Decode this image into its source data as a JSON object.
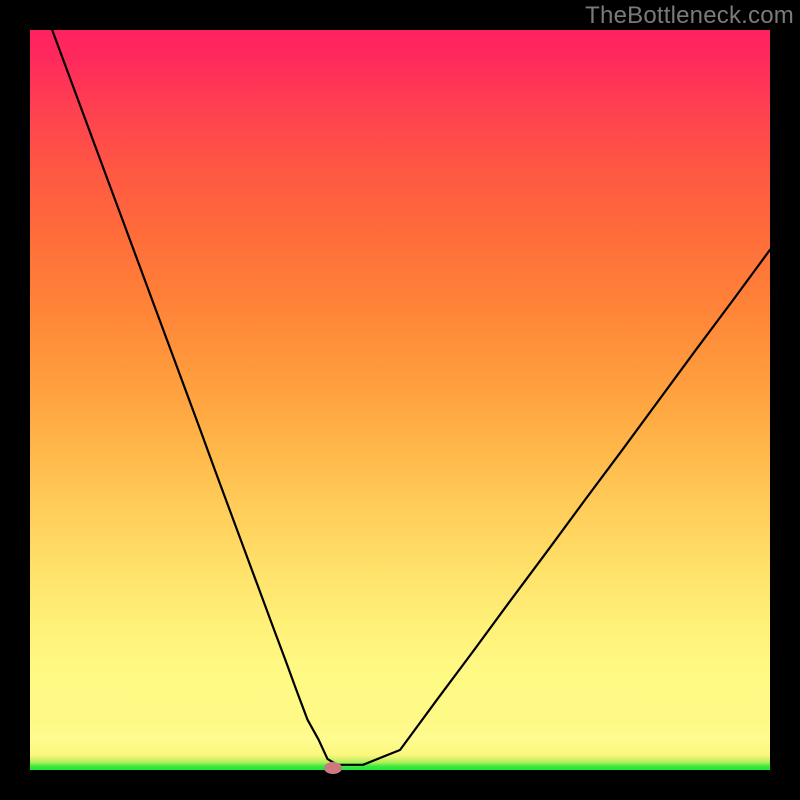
{
  "watermark": "TheBottleneck.com",
  "colors": {
    "frame_bg": "#000000",
    "marker": "#cc7a7f",
    "curve": "#000000"
  },
  "chart_data": {
    "type": "line",
    "title": "",
    "xlabel": "",
    "ylabel": "",
    "xlim": [
      0,
      100
    ],
    "ylim": [
      0,
      100
    ],
    "x": [
      3,
      5,
      7,
      9,
      11,
      13,
      15,
      17,
      19,
      21,
      23,
      25,
      27,
      29,
      31,
      33,
      34.5,
      36,
      37.5,
      39,
      40.2,
      41.5,
      45,
      50,
      55,
      60,
      65,
      70,
      75,
      80,
      85,
      90,
      95,
      100
    ],
    "y": [
      100,
      94.6,
      89.2,
      83.8,
      78.4,
      73,
      67.6,
      62.2,
      56.8,
      51.4,
      46,
      40.5,
      35.1,
      29.7,
      24.3,
      18.9,
      14.9,
      10.8,
      6.8,
      4.1,
      1.5,
      0.7,
      0.7,
      2.7,
      9.5,
      16.2,
      23,
      29.7,
      36.5,
      43.2,
      50,
      56.8,
      63.5,
      70.3
    ],
    "marker": {
      "x": 41,
      "y": 0.3
    },
    "gradient_stops": [
      {
        "pos": 0.0,
        "color": "#17e840"
      },
      {
        "pos": 0.005,
        "color": "#3de83b"
      },
      {
        "pos": 0.01,
        "color": "#a8f05c"
      },
      {
        "pos": 0.015,
        "color": "#d8f26a"
      },
      {
        "pos": 0.02,
        "color": "#fbf77d"
      },
      {
        "pos": 0.04,
        "color": "#fffb8f"
      },
      {
        "pos": 0.07,
        "color": "#fffa86"
      },
      {
        "pos": 0.13,
        "color": "#fffa84"
      },
      {
        "pos": 0.2,
        "color": "#fff078"
      },
      {
        "pos": 0.27,
        "color": "#ffe16a"
      },
      {
        "pos": 0.35,
        "color": "#ffce5a"
      },
      {
        "pos": 0.43,
        "color": "#ffb84a"
      },
      {
        "pos": 0.52,
        "color": "#ff9f3e"
      },
      {
        "pos": 0.62,
        "color": "#ff8538"
      },
      {
        "pos": 0.72,
        "color": "#ff6d3a"
      },
      {
        "pos": 0.82,
        "color": "#ff5544"
      },
      {
        "pos": 0.9,
        "color": "#ff3e52"
      },
      {
        "pos": 0.96,
        "color": "#ff2a5c"
      },
      {
        "pos": 1.0,
        "color": "#ff2160"
      }
    ]
  }
}
